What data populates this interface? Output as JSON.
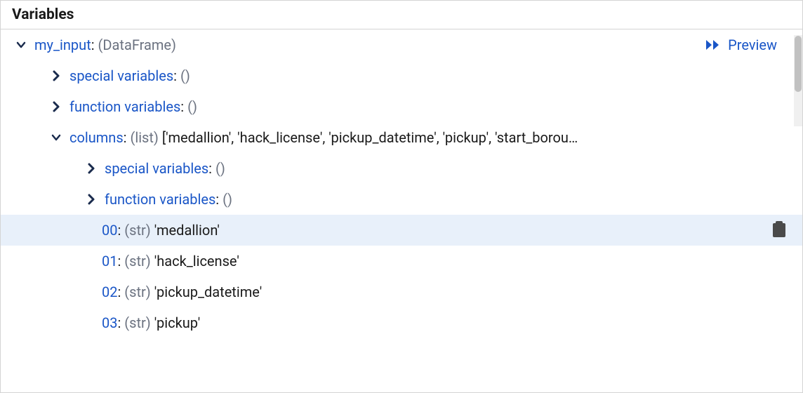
{
  "header": {
    "title": "Variables"
  },
  "preview": {
    "label": "Preview"
  },
  "root": {
    "name": "my_input",
    "type": "(DataFrame)"
  },
  "groups": {
    "special": {
      "name": "special variables",
      "value": "()"
    },
    "function": {
      "name": "function variables",
      "value": "()"
    },
    "columns": {
      "name": "columns",
      "type": "(list)",
      "preview": "['medallion', 'hack_license', 'pickup_datetime', 'pickup', 'start_borou…"
    }
  },
  "columns_children": {
    "special": {
      "name": "special variables",
      "value": "()"
    },
    "function": {
      "name": "function variables",
      "value": "()"
    }
  },
  "items": [
    {
      "idx": "00",
      "type": "(str)",
      "value": "'medallion'"
    },
    {
      "idx": "01",
      "type": "(str)",
      "value": "'hack_license'"
    },
    {
      "idx": "02",
      "type": "(str)",
      "value": "'pickup_datetime'"
    },
    {
      "idx": "03",
      "type": "(str)",
      "value": "'pickup'"
    }
  ]
}
